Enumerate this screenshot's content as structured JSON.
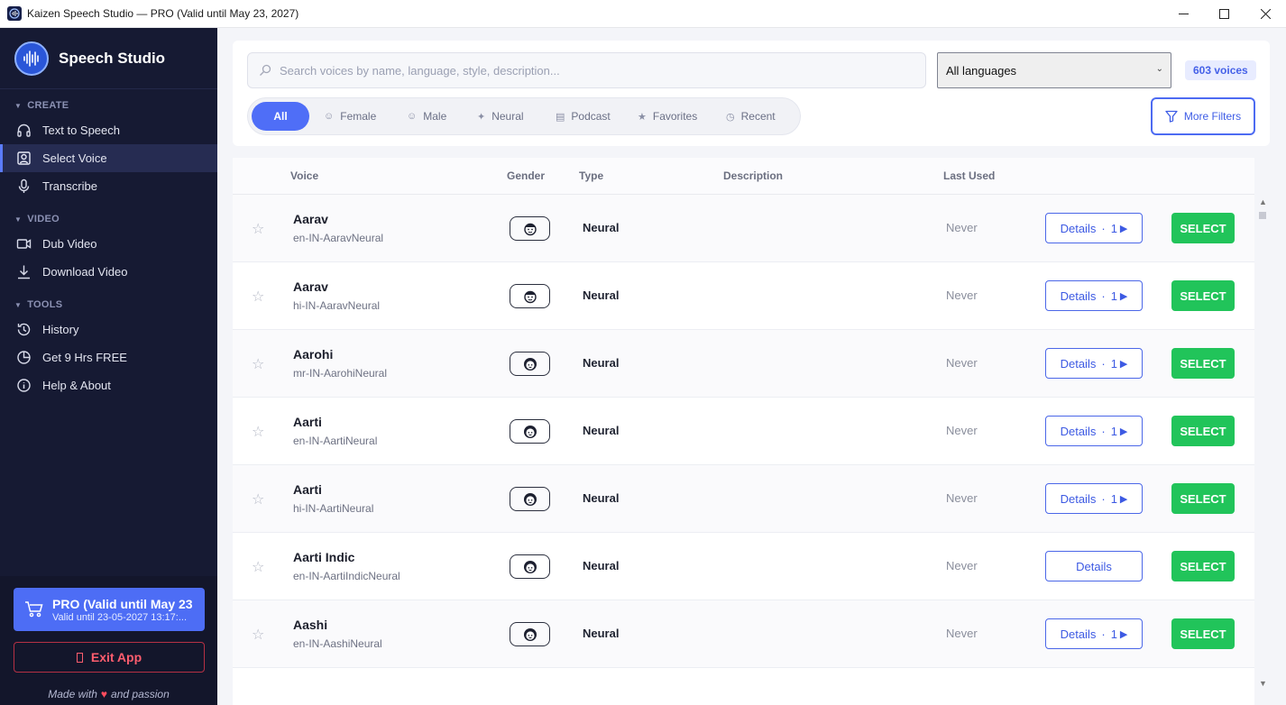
{
  "window": {
    "title": "Kaizen Speech Studio — PRO (Valid until May 23, 2027)",
    "minimize": "—",
    "maximize": "☐",
    "close": "✕"
  },
  "sidebar": {
    "brand": "Speech Studio",
    "sections": [
      {
        "title": "CREATE",
        "items": [
          {
            "label": "Text to Speech",
            "icon": "headphones-icon"
          },
          {
            "label": "Select Voice",
            "icon": "voice-profile-icon",
            "active": true
          },
          {
            "label": "Transcribe",
            "icon": "microphone-icon"
          }
        ]
      },
      {
        "title": "VIDEO",
        "items": [
          {
            "label": "Dub Video",
            "icon": "video-camera-icon"
          },
          {
            "label": "Download Video",
            "icon": "download-icon"
          }
        ]
      },
      {
        "title": "TOOLS",
        "items": [
          {
            "label": "History",
            "icon": "history-icon"
          },
          {
            "label": "Get 9 Hrs FREE",
            "icon": "pie-chart-icon"
          },
          {
            "label": "Help & About",
            "icon": "info-icon"
          }
        ]
      }
    ],
    "pro": {
      "title": "PRO (Valid until May 23",
      "subtitle": "Valid until 23-05-2027 13:17:..."
    },
    "exit": "Exit App",
    "made_with_prefix": "Made with",
    "heart": "♥",
    "made_with_suffix": "and passion"
  },
  "filters": {
    "search_placeholder": "Search voices by name, language, style, description...",
    "language": "All languages",
    "voice_count": "603 voices",
    "chips": [
      {
        "label": "All",
        "icon": ""
      },
      {
        "label": "Female",
        "icon": "female-icon"
      },
      {
        "label": "Male",
        "icon": "male-icon"
      },
      {
        "label": "Neural",
        "icon": "sparkle-icon"
      },
      {
        "label": "Podcast",
        "icon": "podcast-icon"
      },
      {
        "label": "Favorites",
        "icon": "star-icon"
      },
      {
        "label": "Recent",
        "icon": "clock-icon"
      }
    ],
    "more_filters": "More Filters"
  },
  "table": {
    "columns": {
      "voice": "Voice",
      "gender": "Gender",
      "type": "Type",
      "description": "Description",
      "last_used": "Last Used"
    },
    "rows": [
      {
        "name": "Aarav",
        "id": "en-IN-AaravNeural",
        "gender": "male",
        "type": "Neural",
        "last_used": "Never",
        "details": "Details",
        "samples": "1",
        "select": "SELECT"
      },
      {
        "name": "Aarav",
        "id": "hi-IN-AaravNeural",
        "gender": "male",
        "type": "Neural",
        "last_used": "Never",
        "details": "Details",
        "samples": "1",
        "select": "SELECT"
      },
      {
        "name": "Aarohi",
        "id": "mr-IN-AarohiNeural",
        "gender": "female",
        "type": "Neural",
        "last_used": "Never",
        "details": "Details",
        "samples": "1",
        "select": "SELECT"
      },
      {
        "name": "Aarti",
        "id": "en-IN-AartiNeural",
        "gender": "female",
        "type": "Neural",
        "last_used": "Never",
        "details": "Details",
        "samples": "1",
        "select": "SELECT"
      },
      {
        "name": "Aarti",
        "id": "hi-IN-AartiNeural",
        "gender": "female",
        "type": "Neural",
        "last_used": "Never",
        "details": "Details",
        "samples": "1",
        "select": "SELECT"
      },
      {
        "name": "Aarti Indic",
        "id": "en-IN-AartiIndicNeural",
        "gender": "female",
        "type": "Neural",
        "last_used": "Never",
        "details": "Details",
        "samples": "",
        "select": "SELECT"
      },
      {
        "name": "Aashi",
        "id": "en-IN-AashiNeural",
        "gender": "female",
        "type": "Neural",
        "last_used": "Never",
        "details": "Details",
        "samples": "1",
        "select": "SELECT"
      }
    ]
  },
  "colors": {
    "accent": "#4f6ef7",
    "select": "#21c45a",
    "sidebar": "#161a33",
    "exit": "#ff5d6e"
  }
}
